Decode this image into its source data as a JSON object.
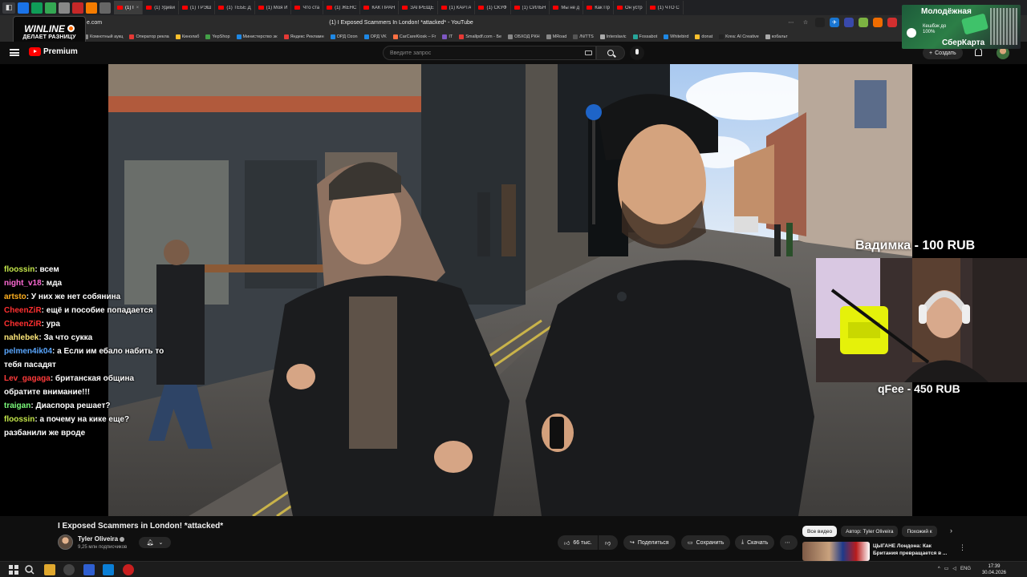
{
  "browser": {
    "tabs": [
      {
        "label": "(1) I",
        "active": true
      },
      {
        "label": "(1) Удиви"
      },
      {
        "label": "(1) ТРЭШ"
      },
      {
        "label": "(1) ТЕБЕ Д"
      },
      {
        "label": "(1) Моя И"
      },
      {
        "label": "Что ста"
      },
      {
        "label": "(1) ЖЕНС"
      },
      {
        "label": "КАК ПРАН"
      },
      {
        "label": "ЗАПРЕЩЕ"
      },
      {
        "label": "(1) КАРТА"
      },
      {
        "label": "(1) СКУФ"
      },
      {
        "label": "(1) СИЛЬН"
      },
      {
        "label": "Мы не д"
      },
      {
        "label": "Как Пр"
      },
      {
        "label": "Он устр"
      },
      {
        "label": "(1) ЧТО С"
      }
    ],
    "url_fragment": "e.com",
    "page_title": "(1) I Exposed Scammers In London! *attacked* - YouTube",
    "bookmarks": [
      "Комнотный аукц",
      "Оператор рекла",
      "Кинолаб",
      "YepShop",
      "Министерство эк",
      "Яндекс Рекламн",
      "ОРД Ozon",
      "ОРД VK",
      "CarCareKiosk – Fr",
      "IT",
      "Smallpdf.com - Бе",
      "ОБХОД РКН",
      "MRoad",
      "/N/TTS",
      "Interslavic",
      "Fossabot",
      "Whitebird",
      "donat",
      "Krea: AI Creative",
      "кобальт"
    ],
    "bookmark_colors": [
      "#888",
      "#e53935",
      "#fbc02d",
      "#43a047",
      "#1e88e5",
      "#e53935",
      "#1e88e5",
      "#1e88e5",
      "#ff7043",
      "#7e57c2",
      "#e53935",
      "#888",
      "#888",
      "#555",
      "#aaa",
      "#26a69a",
      "#1e88e5",
      "#fbc02d",
      "#222",
      "#aaa"
    ]
  },
  "winline_ad": {
    "brand": "WINLINE",
    "tagline": "ДЕЛАЕТ РАЗНИЦУ"
  },
  "sber_ad": {
    "line1": "Молодёжная",
    "line2": "Кешбэк до 100%",
    "line3": "СберКарта"
  },
  "youtube": {
    "logo_text": "Premium",
    "search_placeholder": "Введите запрос",
    "create_label": "Создать"
  },
  "stream_chat": [
    {
      "nick": "floossin",
      "color": "#c4e64a",
      "text": "всем"
    },
    {
      "nick": "night_v18",
      "color": "#ff6ad5",
      "text": "мда"
    },
    {
      "nick": "artsto",
      "color": "#ffb020",
      "text": "У них же нет собянина"
    },
    {
      "nick": "CheenZiR",
      "color": "#ff3030",
      "text": "ещё и пособие попадается"
    },
    {
      "nick": "CheenZiR",
      "color": "#ff3030",
      "text": "ура"
    },
    {
      "nick": "nahlebek",
      "color": "#ffe87a",
      "text": "За что сукка"
    },
    {
      "nick": "pelmen4ik04",
      "color": "#5aa7ff",
      "text": "а Если им ебало набить то тебя пасадят"
    },
    {
      "nick": "Lev_gagaga",
      "color": "#ff3b3b",
      "text": "британская община обратите внимание!!!"
    },
    {
      "nick": "traigan",
      "color": "#7CFC7C",
      "text": "Диаспора решает?"
    },
    {
      "nick": "floossin",
      "color": "#c4e64a",
      "text": "а почему на кике еще? разбанили же вроде"
    }
  ],
  "donations": [
    {
      "text": "Вадимка - 100 RUB"
    },
    {
      "text": "qFee - 450 RUB"
    }
  ],
  "video_info": {
    "title": "I Exposed Scammers in London! *attacked*",
    "channel": "Tyler Oliveira",
    "subscribers": "9,25 млн подписчиков",
    "likes": "66 тыс.",
    "share": "Поделиться",
    "save": "Сохранить",
    "download": "Скачать",
    "more": "⋯"
  },
  "chips": [
    {
      "label": "Все видео",
      "selected": true
    },
    {
      "label": "Автор: Tyler Oliveira"
    },
    {
      "label": "Похожий к"
    }
  ],
  "recommendation": {
    "title": "ЦЫГАНЕ Лондона: Как Британия превращается в ..."
  },
  "taskbar": {
    "lang": "ENG",
    "time": "17:39",
    "date": "30.04.2026"
  }
}
